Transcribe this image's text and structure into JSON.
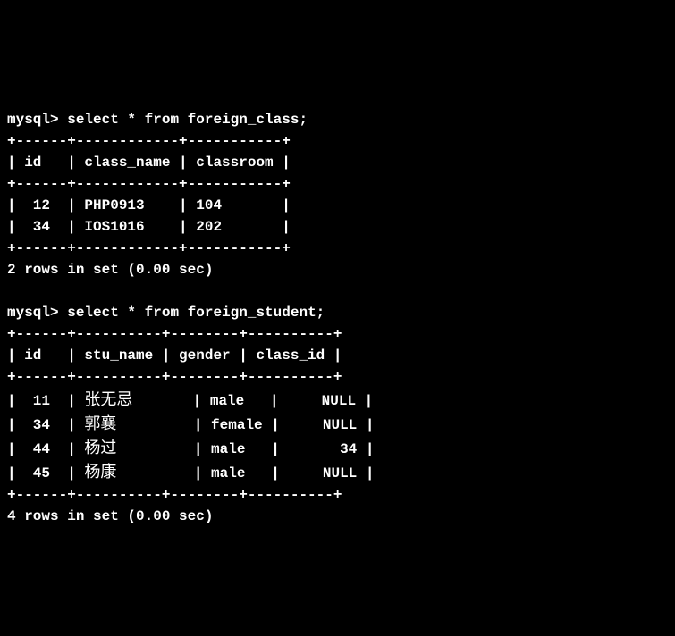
{
  "queries": [
    {
      "prompt": "mysql>",
      "sql": "select * from foreign_class;",
      "border_top": "+------+------------+-----------+",
      "header_row": "| id   | class_name | classroom |",
      "border_mid": "+------+------------+-----------+",
      "rows": [
        "|  12  | PHP0913    | 104       |",
        "|  34  | IOS1016    | 202       |"
      ],
      "border_bot": "+------+------------+-----------+",
      "result_msg": "2 rows in set (0.00 sec)"
    },
    {
      "prompt": "mysql>",
      "sql": "select * from foreign_student;",
      "border_top": "+------+----------+--------+----------+",
      "header_row": "| id   | stu_name | gender | class_id |",
      "border_mid": "+------+----------+--------+----------+",
      "rows": [
        {
          "pre": "|  11  | ",
          "cjk": "张无忌",
          "post": "       | male   |     NULL |"
        },
        {
          "pre": "|  34  | ",
          "cjk": "郭襄",
          "post": "         | female |     NULL |"
        },
        {
          "pre": "|  44  | ",
          "cjk": "杨过",
          "post": "         | male   |       34 |"
        },
        {
          "pre": "|  45  | ",
          "cjk": "杨康",
          "post": "         | male   |     NULL |"
        }
      ],
      "border_bot": "+------+----------+--------+----------+",
      "result_msg": "4 rows in set (0.00 sec)"
    }
  ]
}
